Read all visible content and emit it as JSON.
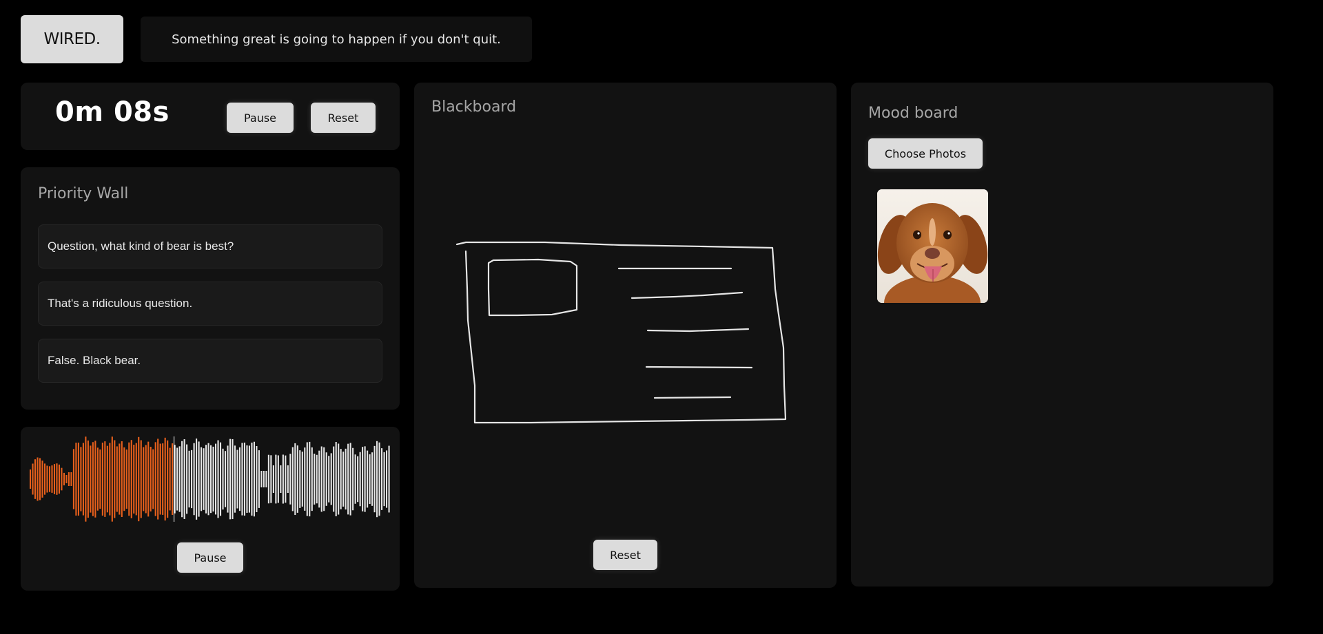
{
  "header": {
    "logo_label": "WIRED.",
    "quote": "Something great is going to happen if you don't quit."
  },
  "timer": {
    "display": "0m 08s",
    "pause_label": "Pause",
    "reset_label": "Reset"
  },
  "priority_wall": {
    "title": "Priority Wall",
    "items": [
      "Question, what kind of bear is best?",
      "That's a ridiculous question.",
      "False. Black bear."
    ]
  },
  "audio": {
    "pause_label": "Pause",
    "progress": 0.4,
    "played_color": "#e8601c",
    "unplayed_color": "#e6e6e6"
  },
  "blackboard": {
    "title": "Blackboard",
    "reset_label": "Reset"
  },
  "mood_board": {
    "title": "Mood board",
    "choose_label": "Choose Photos",
    "photos": [
      {
        "icon": "dog-photo"
      }
    ]
  },
  "colors": {
    "background": "#000000",
    "panel": "#121212",
    "button": "#dcdcdc",
    "accent": "#e8601c"
  }
}
